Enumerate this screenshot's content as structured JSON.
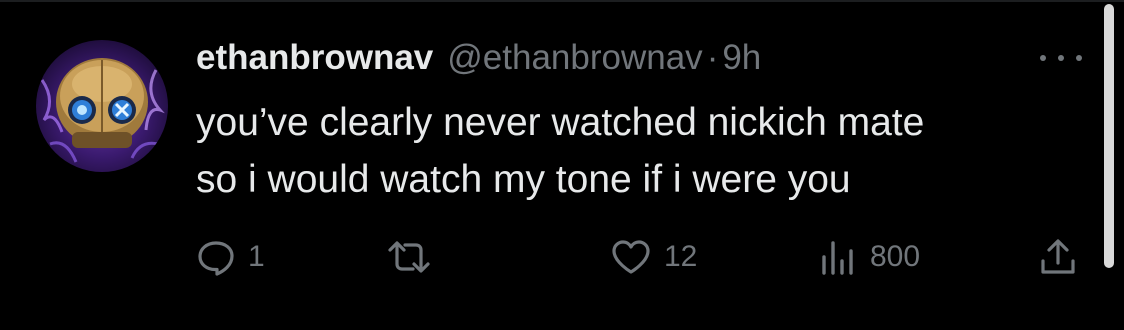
{
  "tweet": {
    "display_name": "ethanbrownav",
    "handle": "@ethanbrownav",
    "separator": "·",
    "time": "9h",
    "text_line_1": "you’ve clearly never watched nickich mate",
    "text_line_2": "so i would watch my tone if i were you"
  },
  "actions": {
    "reply": {
      "icon": "reply-icon",
      "count": "1"
    },
    "retweet": {
      "icon": "retweet-icon",
      "count": ""
    },
    "like": {
      "icon": "heart-icon",
      "count": "12"
    },
    "views": {
      "icon": "views-chart-icon",
      "count": "800"
    },
    "share": {
      "icon": "share-icon"
    }
  },
  "colors": {
    "background": "#000000",
    "primary_text": "#e7e9ea",
    "secondary_text": "#71767b",
    "scrollbar": "#d9d9d9"
  }
}
